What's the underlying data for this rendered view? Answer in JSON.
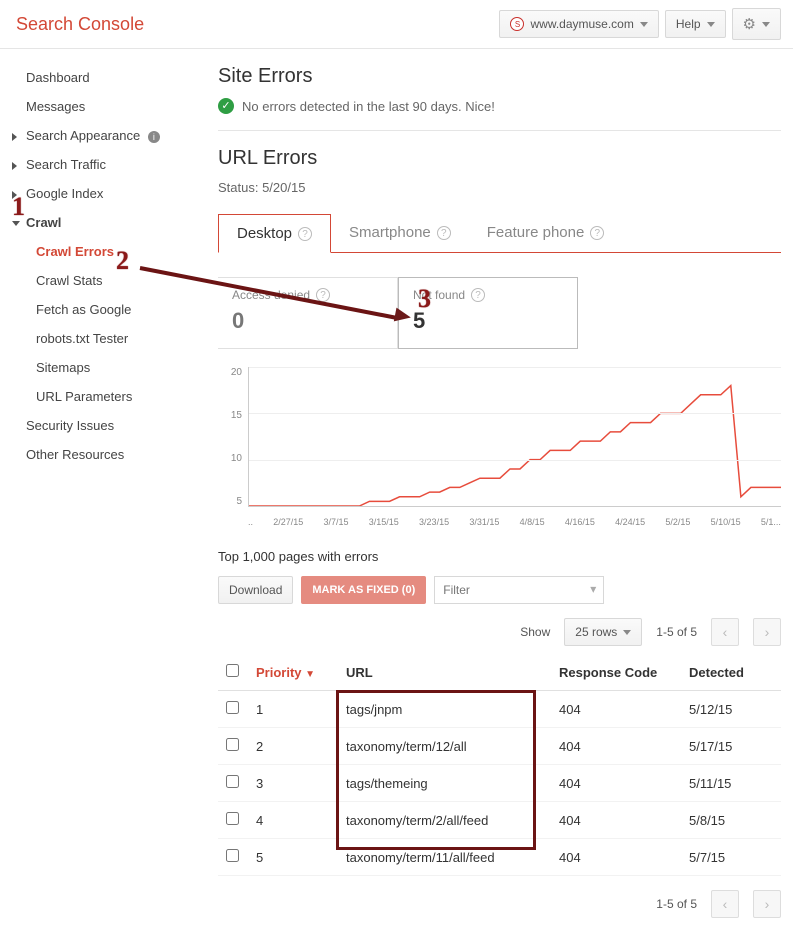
{
  "topbar": {
    "title": "Search Console",
    "site_label": "www.daymuse.com",
    "help_label": "Help"
  },
  "sidebar": {
    "dashboard": "Dashboard",
    "messages": "Messages",
    "search_appearance": "Search Appearance",
    "search_traffic": "Search Traffic",
    "google_index": "Google Index",
    "crawl": "Crawl",
    "crawl_children": {
      "crawl_errors": "Crawl Errors",
      "crawl_stats": "Crawl Stats",
      "fetch_as_google": "Fetch as Google",
      "robots": "robots.txt Tester",
      "sitemaps": "Sitemaps",
      "url_params": "URL Parameters"
    },
    "security": "Security Issues",
    "other": "Other Resources"
  },
  "site_errors": {
    "title": "Site Errors",
    "status": "No errors detected in the last 90 days. Nice!"
  },
  "url_errors": {
    "title": "URL Errors",
    "status": "Status: 5/20/15"
  },
  "tabs": {
    "desktop": "Desktop",
    "smartphone": "Smartphone",
    "feature_phone": "Feature phone"
  },
  "stats": {
    "access_denied_label": "Access denied",
    "access_denied_value": "0",
    "not_found_label": "Not found",
    "not_found_value": "5"
  },
  "table_caption": "Top 1,000 pages with errors",
  "toolbar": {
    "download": "Download",
    "mark_fixed": "MARK AS FIXED (0)",
    "filter_placeholder": "Filter",
    "show_label": "Show",
    "rows_label": "25 rows",
    "range": "1-5 of 5"
  },
  "columns": {
    "priority": "Priority",
    "url": "URL",
    "response": "Response Code",
    "detected": "Detected"
  },
  "rows": [
    {
      "priority": "1",
      "url": "tags/jnpm",
      "code": "404",
      "detected": "5/12/15"
    },
    {
      "priority": "2",
      "url": "taxonomy/term/12/all",
      "code": "404",
      "detected": "5/17/15"
    },
    {
      "priority": "3",
      "url": "tags/themeing",
      "code": "404",
      "detected": "5/11/15"
    },
    {
      "priority": "4",
      "url": "taxonomy/term/2/all/feed",
      "code": "404",
      "detected": "5/8/15"
    },
    {
      "priority": "5",
      "url": "taxonomy/term/11/all/feed",
      "code": "404",
      "detected": "5/7/15"
    }
  ],
  "annotations": {
    "n1": "1",
    "n2": "2",
    "n3": "3"
  },
  "chart_data": {
    "type": "line",
    "x": [
      "..",
      "2/27/15",
      "3/7/15",
      "3/15/15",
      "3/23/15",
      "3/31/15",
      "4/8/15",
      "4/16/15",
      "4/24/15",
      "5/2/15",
      "5/10/15",
      "5/1..."
    ],
    "values": [
      5,
      5,
      5,
      5,
      5,
      5,
      5,
      5,
      5,
      5,
      5,
      5,
      5.5,
      5.5,
      5.5,
      6,
      6,
      6,
      6.5,
      6.5,
      7,
      7,
      7.5,
      8,
      8,
      8,
      9,
      9,
      10,
      10,
      11,
      11,
      11,
      12,
      12,
      12,
      13,
      13,
      14,
      14,
      14,
      15,
      15,
      15,
      16,
      17,
      17,
      17,
      18,
      6,
      7,
      7,
      7,
      7
    ],
    "ylabel": "",
    "xlabel": "",
    "ylim": [
      5,
      20
    ],
    "y_ticks": [
      "20",
      "15",
      "10",
      "5"
    ]
  }
}
